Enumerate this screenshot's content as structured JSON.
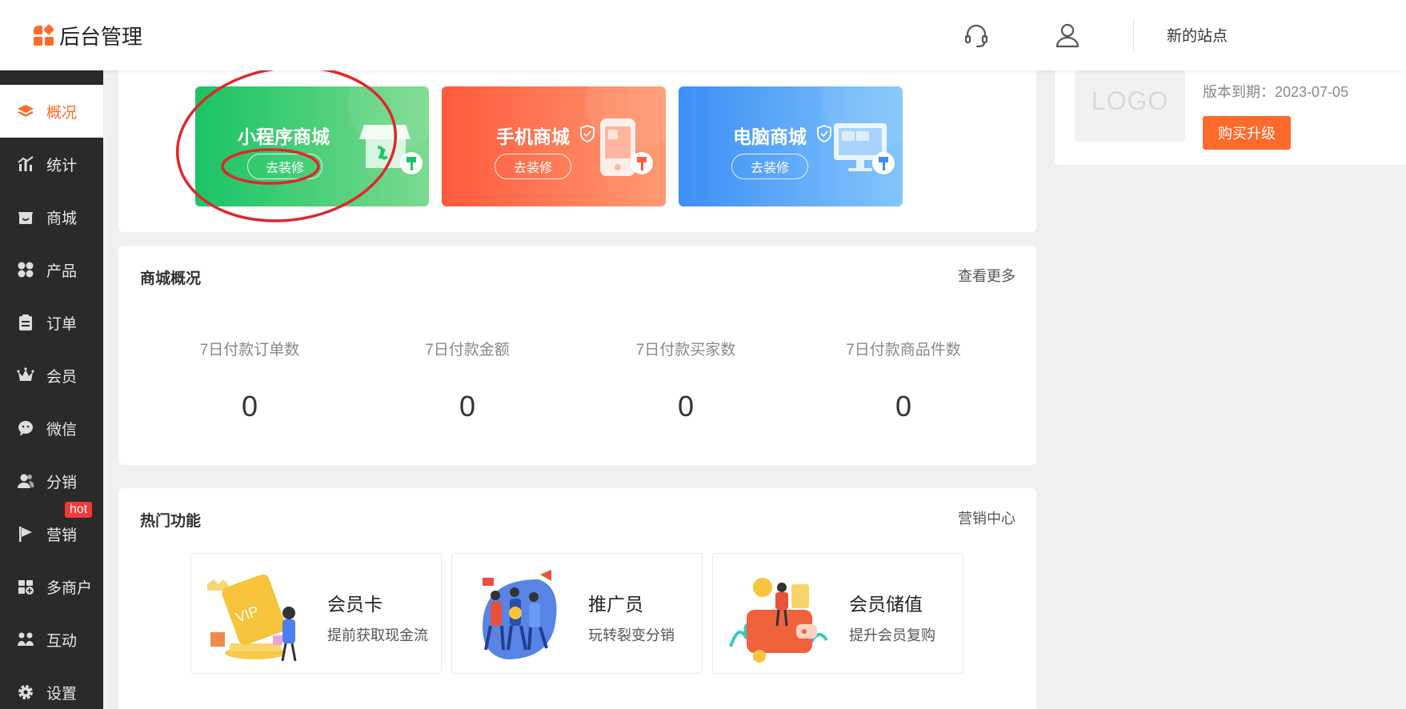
{
  "header": {
    "app_title": "后台管理",
    "site_name": "新的站点",
    "icons": [
      "headset-icon",
      "user-icon"
    ]
  },
  "sidebar": {
    "items": [
      {
        "label": "概况",
        "icon": "layers-icon",
        "active": true
      },
      {
        "label": "统计",
        "icon": "chart-icon"
      },
      {
        "label": "商城",
        "icon": "shop-icon"
      },
      {
        "label": "产品",
        "icon": "grid-icon"
      },
      {
        "label": "订单",
        "icon": "clipboard-icon"
      },
      {
        "label": "会员",
        "icon": "crown-icon"
      },
      {
        "label": "微信",
        "icon": "wechat-icon"
      },
      {
        "label": "分销",
        "icon": "users-icon"
      },
      {
        "label": "营销",
        "icon": "flag-icon",
        "badge": "hot"
      },
      {
        "label": "多商户",
        "icon": "store-plus-icon"
      },
      {
        "label": "互动",
        "icon": "people-icon"
      },
      {
        "label": "设置",
        "icon": "gear-icon"
      }
    ]
  },
  "stores": [
    {
      "name": "小程序商城",
      "button": "去装修",
      "color_from": "#19c464",
      "color_to": "#7bda8e"
    },
    {
      "name": "手机商城",
      "button": "去装修",
      "color_from": "#ff5a3c",
      "color_to": "#ff9a72"
    },
    {
      "name": "电脑商城",
      "button": "去装修",
      "color_from": "#3d8ef7",
      "color_to": "#82c6fb"
    }
  ],
  "overview": {
    "title": "商城概况",
    "more_link": "查看更多",
    "stats": [
      {
        "label": "7日付款订单数",
        "value": "0"
      },
      {
        "label": "7日付款金额",
        "value": "0"
      },
      {
        "label": "7日付款买家数",
        "value": "0"
      },
      {
        "label": "7日付款商品件数",
        "value": "0"
      }
    ]
  },
  "hot_features": {
    "title": "热门功能",
    "link": "营销中心",
    "items": [
      {
        "title": "会员卡",
        "subtitle": "提前获取现金流"
      },
      {
        "title": "推广员",
        "subtitle": "玩转裂变分销"
      },
      {
        "title": "会员储值",
        "subtitle": "提升会员复购"
      }
    ]
  },
  "account": {
    "logo_placeholder": "LOGO",
    "expire_text": "版本到期：2023-07-05",
    "upgrade_button": "购买升级"
  },
  "colors": {
    "accent": "#ff6a2b",
    "sidebar_bg": "#2a2a2a",
    "hot_badge": "#f23a3a",
    "annotation": "#e0262b"
  }
}
